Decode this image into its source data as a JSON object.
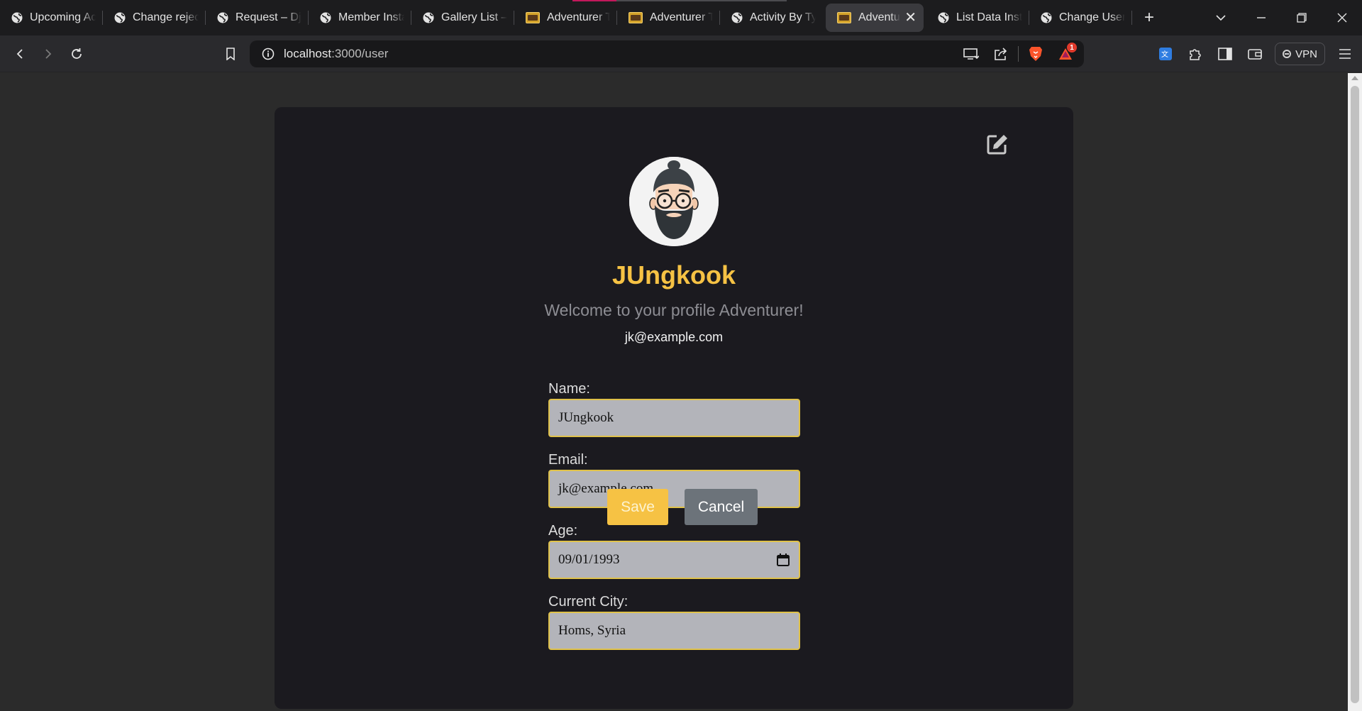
{
  "browser": {
    "tabs": [
      {
        "title": "Upcoming Ac",
        "favicon": "globe-icon"
      },
      {
        "title": "Change reject",
        "favicon": "globe-icon"
      },
      {
        "title": "Request – Dja",
        "favicon": "globe-icon"
      },
      {
        "title": "Member Insta",
        "favicon": "globe-icon"
      },
      {
        "title": "Gallery List –",
        "favicon": "globe-icon"
      },
      {
        "title": "Adventurer To",
        "favicon": "app-icon"
      },
      {
        "title": "Adventurer To",
        "favicon": "app-icon"
      },
      {
        "title": "Activity By Ty",
        "favicon": "globe-icon"
      },
      {
        "title": "Adventur",
        "favicon": "app-icon",
        "active": true
      },
      {
        "title": "List Data Insta",
        "favicon": "globe-icon"
      },
      {
        "title": "Change Users",
        "favicon": "globe-icon"
      }
    ],
    "url_host": "localhost",
    "url_path": ":3000/user",
    "notification_count": "1",
    "vpn_label": "VPN",
    "accent_color": "#f6c244"
  },
  "profile": {
    "username": "JUngkook",
    "welcome": "Welcome to your profile Adventurer!",
    "email": "jk@example.com"
  },
  "form": {
    "name_label": "Name:",
    "name_value": "JUngkook",
    "email_label": "Email:",
    "email_value": "jk@example.com",
    "age_label": "Age:",
    "age_value": "09/01/1993",
    "city_label": "Current City:",
    "city_value": "Homs, Syria",
    "save_label": "Save",
    "cancel_label": "Cancel"
  }
}
